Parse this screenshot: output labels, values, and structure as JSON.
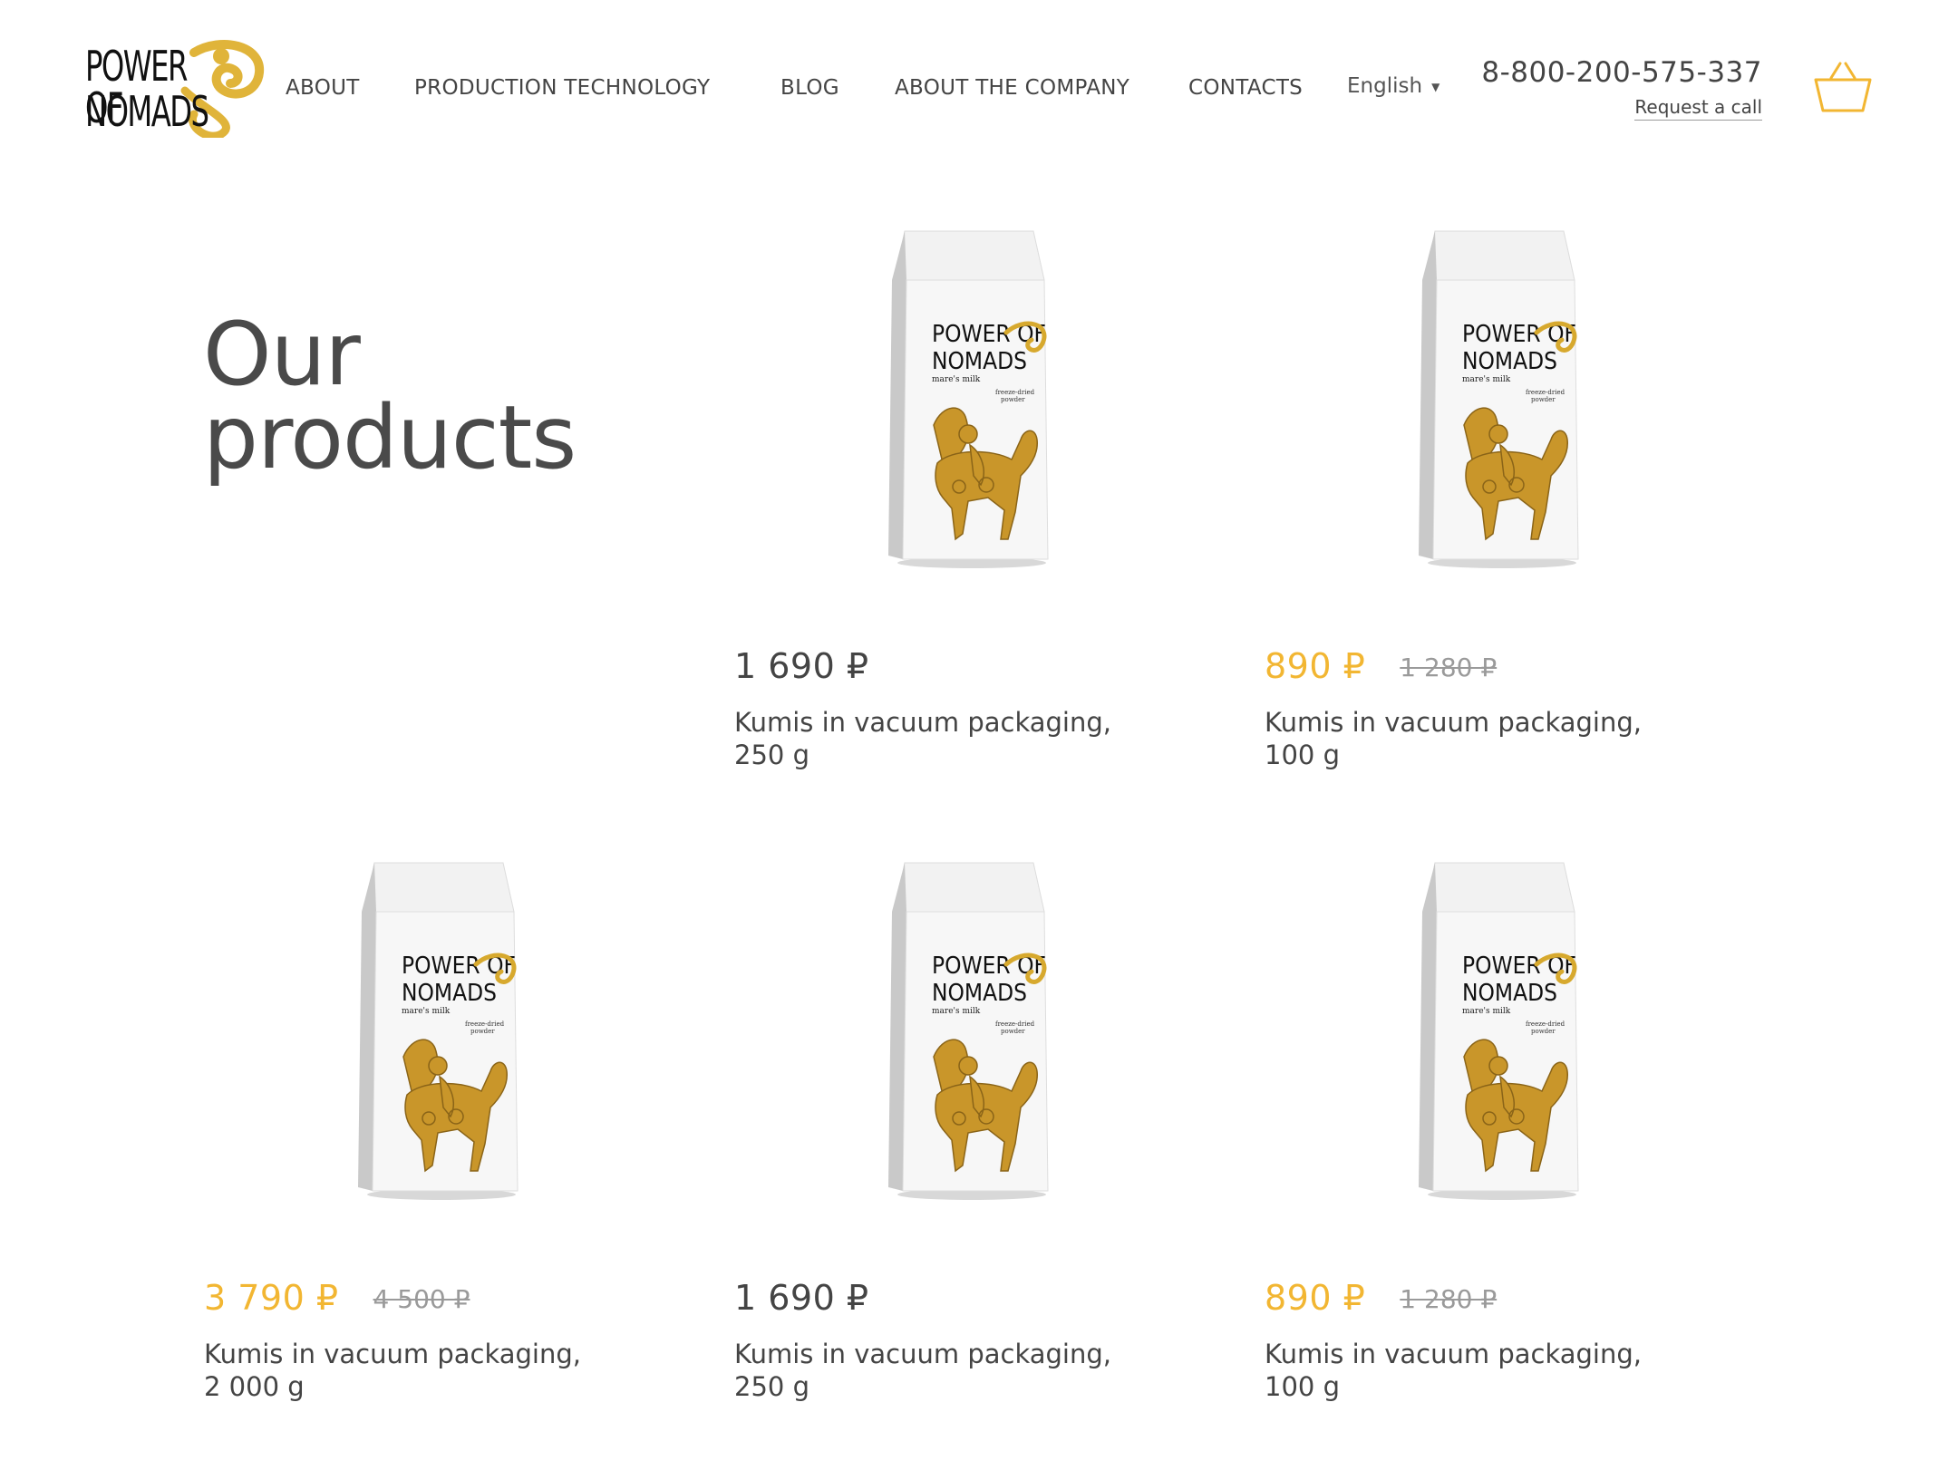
{
  "header": {
    "logo_text_line1": "POWER OF",
    "logo_text_line2": "NOMADS",
    "nav": [
      "ABOUT",
      "PRODUCTION TECHNOLOGY",
      "BLOG",
      "ABOUT THE COMPANY",
      "CONTACTS"
    ],
    "language": "English",
    "phone": "8-800-200-575-337",
    "request_call": "Request a call",
    "cart_icon": "basket-icon"
  },
  "main": {
    "title_line1": "Our",
    "title_line2": "products"
  },
  "package_art": {
    "brand_line1": "POWER OF",
    "brand_line2": "NOMADS",
    "subtitle": "mare's milk",
    "note_line1": "freeze-dried",
    "note_line2": "powder"
  },
  "products": [
    {
      "price": "1 690 ₽",
      "old_price": "",
      "name_line1": "Kumis in vacuum packaging,",
      "name_line2": "250 g"
    },
    {
      "price": "890 ₽",
      "old_price": "1 280 ₽",
      "name_line1": "Kumis in vacuum packaging,",
      "name_line2": "100 g"
    },
    {
      "price": "3 790 ₽",
      "old_price": "4 500 ₽",
      "name_line1": "Kumis in vacuum packaging,",
      "name_line2": "2 000 g"
    },
    {
      "price": "1 690 ₽",
      "old_price": "",
      "name_line1": "Kumis in vacuum packaging,",
      "name_line2": "250 g"
    },
    {
      "price": "890 ₽",
      "old_price": "1 280 ₽",
      "name_line1": "Kumis in vacuum packaging,",
      "name_line2": "100 g"
    }
  ],
  "colors": {
    "accent": "#f2b632",
    "text": "#444444",
    "old_price": "#9a9a9a"
  }
}
